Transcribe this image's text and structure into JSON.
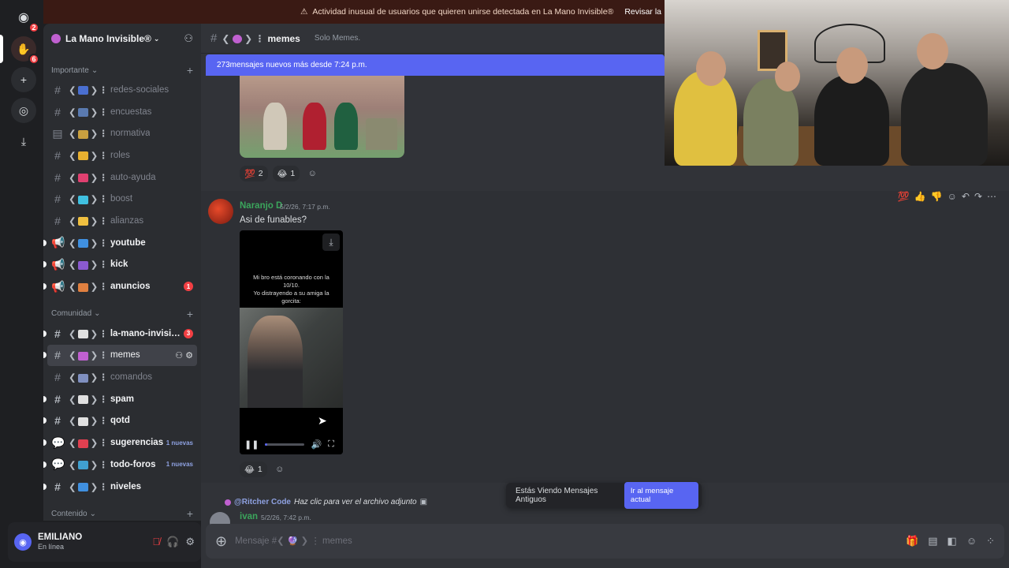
{
  "notice": {
    "text": "Actividad inusual de usuarios que quieren unirse detectada en La Mano Invisible®",
    "link": "Revisar la"
  },
  "rail": {
    "badge_top": "2",
    "badge_second": "6"
  },
  "server": {
    "name": "La Mano Invisible®"
  },
  "categories": {
    "importante": "Importante",
    "comunidad": "Comunidad",
    "contenido": "Contenido"
  },
  "channels": [
    {
      "name": "redes-sociales",
      "emoji_color": "#4a6fd0"
    },
    {
      "name": "encuestas",
      "emoji_color": "#5a7ab0"
    },
    {
      "name": "normativa",
      "emoji_color": "#c9a040"
    },
    {
      "name": "roles",
      "emoji_color": "#e8b030"
    },
    {
      "name": "auto-ayuda",
      "emoji_color": "#e04070"
    },
    {
      "name": "boost",
      "emoji_color": "#40c0e0"
    },
    {
      "name": "alianzas",
      "emoji_color": "#f0c040"
    },
    {
      "name": "youtube",
      "emoji_color": "#4090e0"
    },
    {
      "name": "kick",
      "emoji_color": "#8a5ad0"
    },
    {
      "name": "anuncios",
      "emoji_color": "#e08040",
      "badge": "1"
    },
    {
      "name": "la-mano-invisib...",
      "emoji_color": "#e0e0e0",
      "badge": "3"
    },
    {
      "name": "memes",
      "emoji_color": "#c060d0"
    },
    {
      "name": "comandos",
      "emoji_color": "#8090c0"
    },
    {
      "name": "spam",
      "emoji_color": "#e0e0e0"
    },
    {
      "name": "qotd",
      "emoji_color": "#e0e0e0"
    },
    {
      "name": "sugerencias",
      "emoji_color": "#e04050",
      "new": "1 nuevas"
    },
    {
      "name": "todo-foros",
      "emoji_color": "#40a0d0",
      "new": "1 nuevas"
    },
    {
      "name": "niveles",
      "emoji_color": "#4090e0"
    }
  ],
  "user": {
    "name": "EMILIANO",
    "status": "En línea"
  },
  "header": {
    "channel": "memes",
    "topic": "Solo Memes."
  },
  "new_messages": "273mensajes nuevos más desde 7:24 p.m.",
  "msg1": {
    "reactions": [
      {
        "emoji": "💯",
        "count": "2"
      },
      {
        "emoji": "😂",
        "count": "1"
      }
    ]
  },
  "msg2": {
    "author": "Naranjo D",
    "time": "5/2/26, 7:17 p.m.",
    "content": "Asi de funables?",
    "video_text": "Mi bro está coronando con la 10/10.\nYo distrayendo a su amiga la gorcita:",
    "video_progress": 0.05,
    "reactions": [
      {
        "emoji": "😂",
        "count": "1"
      }
    ]
  },
  "msg3": {
    "reply_name": "@Ritcher Code",
    "reply_text": "Haz clic para ver el archivo adjunto",
    "author": "ivan",
    "time": "5/2/26, 7:42 p.m."
  },
  "old_bar": {
    "text": "Estás Viendo Mensajes Antiguos",
    "button": "Ir al mensaje actual"
  },
  "composer": {
    "placeholder": "Mensaje #❮ 🔮 ❯ ⋮ memes"
  }
}
